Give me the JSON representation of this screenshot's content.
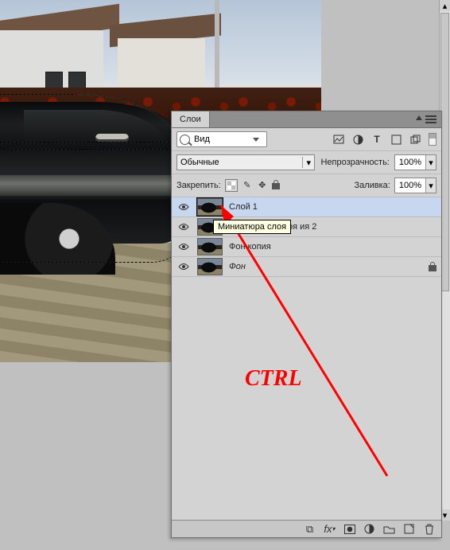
{
  "panel": {
    "tab": "Слои",
    "search_label": "Вид",
    "blend_mode": "Обычные",
    "opacity_label": "Непрозрачность:",
    "opacity_value": "100%",
    "fill_label": "Заливка:",
    "fill_value": "100%",
    "lock_label": "Закрепить:"
  },
  "layers": [
    {
      "name": "Слой 1",
      "selected": true,
      "italic": false,
      "locked": false
    },
    {
      "name": "Миниатюра слоя ия 2",
      "selected": false,
      "italic": false,
      "locked": false
    },
    {
      "name": "Фон копия",
      "selected": false,
      "italic": false,
      "locked": false
    },
    {
      "name": "Фон",
      "selected": false,
      "italic": true,
      "locked": true
    }
  ],
  "tooltip": "Миниатюра слоя",
  "annotation": "CTRL"
}
